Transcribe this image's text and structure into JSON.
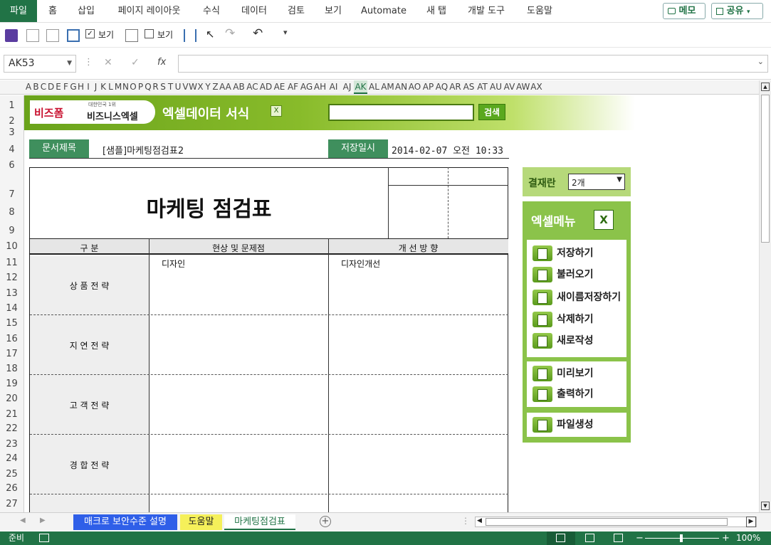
{
  "ribbon": {
    "tabs": [
      "파일",
      "홈",
      "삽입",
      "페이지 레이아웃",
      "수식",
      "데이터",
      "검토",
      "보기",
      "Automate",
      "새 탭",
      "개발 도구",
      "도움말"
    ],
    "memo_label": "메모",
    "share_label": "공유"
  },
  "qat": {
    "view_label_1": "보기",
    "view_label_2": "보기"
  },
  "formula": {
    "name_box": "AK53",
    "fx_label": "fx",
    "cancel_symbol": "✕",
    "enter_symbol": "✓"
  },
  "columns": [
    "A",
    "B",
    "C",
    "D",
    "E",
    "F",
    "G",
    "H",
    "I",
    "J",
    "K",
    "L",
    "M",
    "N",
    "O",
    "P",
    "Q",
    "R",
    "S",
    "T",
    "U",
    "V",
    "W",
    "X",
    "Y",
    "Z",
    "AA",
    "AB",
    "AC",
    "AD",
    "AE",
    "AF",
    "AG",
    "AH",
    "AI",
    "AJ",
    "AK",
    "AL",
    "AM",
    "AN",
    "AO",
    "AP",
    "AQ",
    "AR",
    "AS",
    "AT",
    "AU",
    "AV",
    "AW",
    "AX"
  ],
  "rows": [
    "1",
    "2",
    "3",
    "4",
    "6",
    "7",
    "8",
    "9",
    "10",
    "11",
    "12",
    "13",
    "14",
    "15",
    "16",
    "17",
    "18",
    "19",
    "20",
    "21",
    "22",
    "23",
    "24",
    "25",
    "26",
    "27"
  ],
  "banner": {
    "logo_left": "비즈폼",
    "logo_right_small": "대한민국 1위",
    "logo_right": "비즈니스엑셀",
    "title": "엑셀데이터 서식",
    "search_button": "검색",
    "search_value": ""
  },
  "doc": {
    "title_label": "문서제목",
    "title_value": "[샘플]마케팅점검표2",
    "saved_label": "저장일시",
    "saved_value": "2014-02-07  오전 10:33",
    "heading": "마케팅 점검표",
    "headers": [
      "구   분",
      "현상 및 문제점",
      "개 선 방 향"
    ],
    "rows": [
      {
        "category": "상 품 전 략",
        "issue": "디자인",
        "improve": "디자인개선"
      },
      {
        "category": "지 연 전 략",
        "issue": "",
        "improve": ""
      },
      {
        "category": "고 객 전 략",
        "issue": "",
        "improve": ""
      },
      {
        "category": "경 합 전 략",
        "issue": "",
        "improve": ""
      }
    ]
  },
  "approval": {
    "label": "결재란",
    "select_value": "2개"
  },
  "menu": {
    "title": "엑셀메뉴",
    "group1": [
      "저장하기",
      "불러오기",
      "새이름저장하기",
      "삭제하기",
      "새로작성"
    ],
    "group2": [
      "미리보기",
      "출력하기"
    ],
    "group3": [
      "파일생성"
    ]
  },
  "sheets": {
    "tabs": [
      "매크로 보안수준 설명",
      "도움말",
      "마케팅점검표"
    ],
    "colors": {
      "macro": "#2f5fe8",
      "help": "#f5f05a",
      "active": "#ffffff"
    }
  },
  "status": {
    "ready": "준비",
    "zoom": "100%"
  },
  "colors": {
    "excel_green": "#217346",
    "label_green": "#3f8f5d",
    "banner_green": "#7fb72a"
  }
}
